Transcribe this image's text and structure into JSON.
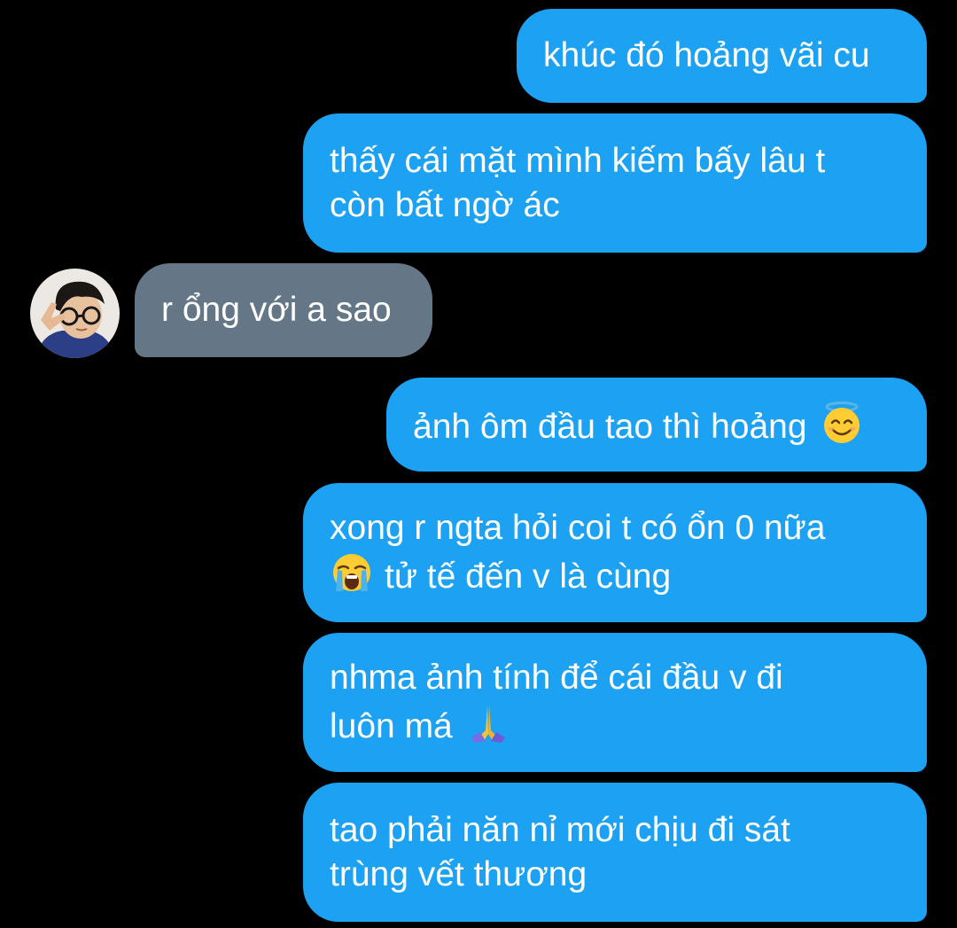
{
  "conversation": {
    "messages": [
      {
        "id": "m1",
        "side": "sent",
        "lines": [
          "khúc đó hoảng vãi cu"
        ]
      },
      {
        "id": "m2",
        "side": "sent",
        "lines": [
          "thấy cái mặt mình kiếm bấy lâu t",
          "còn bất ngờ ác"
        ]
      },
      {
        "id": "m3",
        "side": "received",
        "lines": [
          "r ổng với a sao"
        ]
      },
      {
        "id": "m4",
        "side": "sent",
        "lines": [
          "ảnh ôm đầu tao thì hoảng"
        ],
        "emoji": "smiling-face-with-halo-icon"
      },
      {
        "id": "m5",
        "side": "sent",
        "lines": [
          "xong r ngta hỏi coi t có ổn 0 nữa",
          "tử tế đến v là cùng"
        ],
        "emoji": "loudly-crying-face-icon"
      },
      {
        "id": "m6",
        "side": "sent",
        "lines": [
          "nhma ảnh tính để cái đầu v đi",
          "luôn má"
        ],
        "emoji": "folded-hands-icon"
      },
      {
        "id": "m7",
        "side": "sent",
        "lines": [
          "tao phải năn nỉ mới chịu đi sát",
          "trùng vết thương"
        ]
      }
    ]
  },
  "colors": {
    "background": "#000000",
    "sent_bubble": "#1da1f2",
    "received_bubble": "#657786",
    "text": "#ffffff"
  }
}
